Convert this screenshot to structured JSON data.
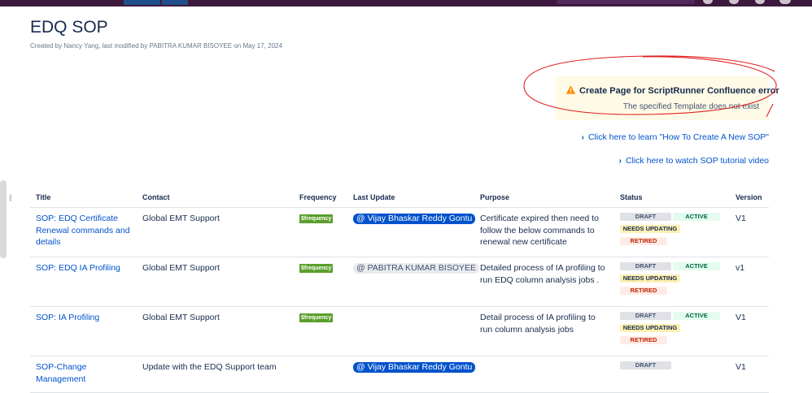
{
  "page": {
    "title": "EDQ SOP",
    "byline": "Created by Nancy Yang, last modified by PABITRA KUMAR BISOYEE on May 17, 2024"
  },
  "error": {
    "title": "Create Page for ScriptRunner Confluence error",
    "message": "The specified Template does not exist",
    "icon": "warning-icon",
    "annotation_color": "#e02020"
  },
  "links": [
    {
      "label": "Click here to learn \"How To Create A New SOP\""
    },
    {
      "label": "Click here to watch SOP tutorial video"
    }
  ],
  "table": {
    "headers": [
      "Title",
      "Contact",
      "Frequency",
      "Last Update",
      "Purpose",
      "Status",
      "Version"
    ],
    "rows": [
      {
        "title": "SOP: EDQ Certificate Renewal commands and details",
        "contact": "Global EMT Support",
        "frequency": "$frequency",
        "last_update": "@ Vijay Bhaskar Reddy Gontu",
        "purpose": "Certificate expired then need to follow the below commands to renewal new certificate",
        "status": [
          "DRAFT",
          "ACTIVE",
          "NEEDS UPDATING",
          "RETIRED"
        ],
        "version": "V1"
      },
      {
        "title": "SOP: EDQ IA Profiling",
        "contact": "Global EMT Support",
        "frequency": "$frequency",
        "last_update": "@ PABITRA KUMAR BISOYEE",
        "purpose": "Detailed process of IA profiling to run EDQ column analysis jobs .",
        "status": [
          "DRAFT",
          "ACTIVE",
          "NEEDS UPDATING",
          "RETIRED"
        ],
        "version": "v1"
      },
      {
        "title": "SOP: IA Profiling",
        "contact": "Global EMT Support",
        "frequency": "$frequency",
        "last_update": "",
        "purpose": "Detail process of IA profiling to run column analysis jobs",
        "status": [
          "DRAFT",
          "ACTIVE",
          "NEEDS UPDATING",
          "RETIRED"
        ],
        "version": "V1"
      },
      {
        "title": "SOP-Change Management",
        "contact": "Update with the EDQ Support team",
        "frequency": "",
        "last_update": "@ Vijay Bhaskar Reddy Gontu",
        "purpose": "",
        "status": [
          "DRAFT"
        ],
        "version": "V1"
      }
    ]
  }
}
